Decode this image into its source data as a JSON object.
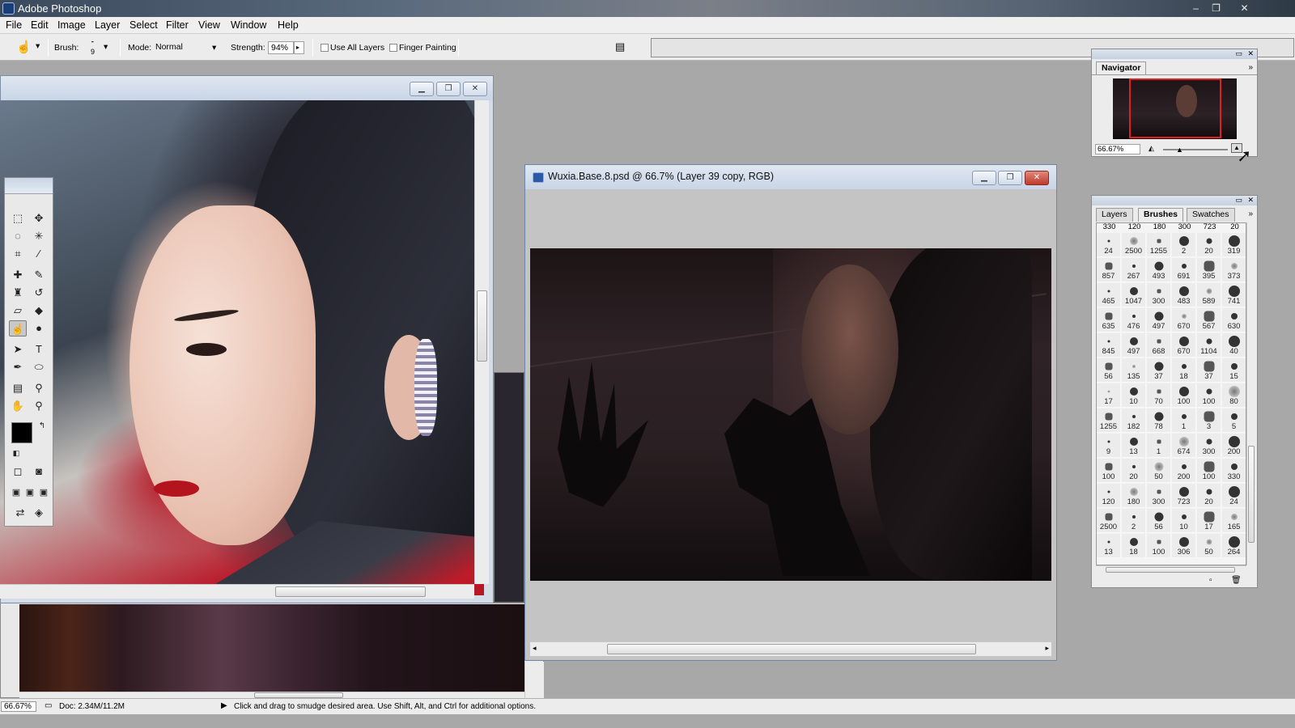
{
  "app": {
    "title": "Adobe Photoshop"
  },
  "menu": [
    "File",
    "Edit",
    "Image",
    "Layer",
    "Select",
    "Filter",
    "View",
    "Window",
    "Help"
  ],
  "options": {
    "brush_label": "Brush:",
    "brush_size": "9",
    "mode_label": "Mode:",
    "mode_value": "Normal",
    "strength_label": "Strength:",
    "strength_value": "94%",
    "use_all_layers": "Use All Layers",
    "finger_painting": "Finger Painting"
  },
  "main_document": {
    "title": "Wuxia.Base.8.psd @ 66.7% (Layer 39 copy, RGB)"
  },
  "navigator": {
    "tab": "Navigator",
    "zoom": "66.67%"
  },
  "brushes_panel": {
    "tabs": [
      "Layers",
      "Brushes",
      "Swatches"
    ],
    "top_row": [
      "330",
      "120",
      "180",
      "300",
      "723",
      "20"
    ],
    "sizes": [
      "24",
      "2500",
      "1255",
      "2",
      "20",
      "319",
      "857",
      "267",
      "493",
      "691",
      "395",
      "373",
      "465",
      "1047",
      "300",
      "483",
      "589",
      "741",
      "635",
      "476",
      "497",
      "670",
      "567",
      "630",
      "845",
      "497",
      "668",
      "670",
      "1104",
      "40",
      "56",
      "135",
      "37",
      "18",
      "37",
      "15",
      "17",
      "10",
      "70",
      "100",
      "100",
      "80",
      "1255",
      "182",
      "78",
      "1",
      "3",
      "5",
      "9",
      "13",
      "1",
      "674",
      "300",
      "200",
      "100",
      "20",
      "50",
      "200",
      "100",
      "330",
      "120",
      "180",
      "300",
      "723",
      "20",
      "24",
      "2500",
      "2",
      "56",
      "10",
      "17",
      "165",
      "13",
      "18",
      "100",
      "306",
      "50",
      "264"
    ]
  },
  "status": {
    "zoom": "66.67%",
    "doc": "Doc: 2.34M/11.2M",
    "hint": "Click and drag to smudge desired area.  Use Shift, Alt, and Ctrl for additional options."
  }
}
